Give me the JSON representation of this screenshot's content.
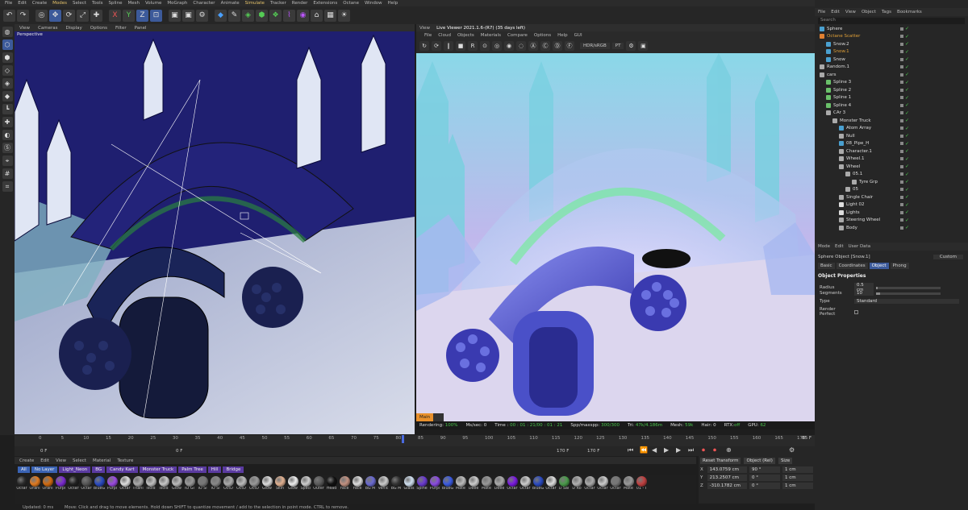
{
  "menubar": [
    "File",
    "Edit",
    "Create",
    "Modes",
    "Select",
    "Tools",
    "Spline",
    "Mesh",
    "Volume",
    "MoGraph",
    "Character",
    "Animate",
    "Simulate",
    "Tracker",
    "Render",
    "Extensions",
    "Octane",
    "Window",
    "Help"
  ],
  "viewport1": {
    "label": "Perspective",
    "menu": [
      "View",
      "Cameras",
      "Display",
      "Options",
      "Filter",
      "Panel"
    ]
  },
  "viewport2": {
    "tabs": [
      "View",
      "Live Viewer 2021.1.6-(R7) (35 days left)"
    ],
    "menu": [
      "File",
      "Cloud",
      "Objects",
      "Materials",
      "Compare",
      "Options",
      "Help",
      "GUI"
    ],
    "color_mode": "HDR/sRGB",
    "pt": "PT",
    "main_tab": "Main",
    "status": {
      "rendering_label": "Rendering:",
      "rendering_val": "100%",
      "mssec": "Ms/sec: 0",
      "time_label": "Time :",
      "time_val": "00 : 01 : 21/00 : 01 : 21",
      "spp_label": "Spp/maxspp:",
      "spp_val": "300/300",
      "tri_label": "Tri:",
      "tri_val": "47k/4.186m",
      "mesh_label": "Mesh:",
      "mesh_val": "59k",
      "hair": "Hair: 0",
      "rtx_label": "RTX:",
      "rtx_val": "off",
      "gpu_label": "GPU:",
      "gpu_val": "62"
    }
  },
  "timeline": {
    "ticks": [
      "0",
      "5",
      "10",
      "15",
      "20",
      "25",
      "30",
      "35",
      "40",
      "45",
      "50",
      "55",
      "60",
      "65",
      "70",
      "75",
      "80",
      "85",
      "90",
      "95",
      "100",
      "105",
      "110",
      "115",
      "120",
      "125",
      "130",
      "135",
      "140",
      "145",
      "150",
      "155",
      "160",
      "165",
      "170"
    ],
    "end": "85 F",
    "start_field": "0 F",
    "current_field": "0 F",
    "end_field": "170 F",
    "max_field": "170 F"
  },
  "materials": {
    "menu": [
      "Create",
      "Edit",
      "View",
      "Select",
      "Material",
      "Texture"
    ],
    "layers": [
      "All",
      "No Layer",
      "Light_Neon",
      "BG",
      "Candy Kart",
      "Monster Truck",
      "Palm Tree",
      "Hill",
      "Bridge"
    ],
    "items": [
      {
        "name": "Octar",
        "color": "#2a2a2a"
      },
      {
        "name": "Orani",
        "color": "#e07a20"
      },
      {
        "name": "Orani",
        "color": "#d06a10"
      },
      {
        "name": "Purpl",
        "color": "#7a2ad0"
      },
      {
        "name": "Octar",
        "color": "#222"
      },
      {
        "name": "Octar",
        "color": "#555"
      },
      {
        "name": "BlueG",
        "color": "#2a4ac0"
      },
      {
        "name": "Purpl",
        "color": "#9a4ae0"
      },
      {
        "name": "Octar",
        "color": "#ddd"
      },
      {
        "name": "Titani",
        "color": "#aaa"
      },
      {
        "name": "isoid",
        "color": "#c0c0c0"
      },
      {
        "name": "isoid",
        "color": "#c8c8c8"
      },
      {
        "name": "Glow",
        "color": "#bbb"
      },
      {
        "name": "IO Gl",
        "color": "#999"
      },
      {
        "name": "IO Sl",
        "color": "#777"
      },
      {
        "name": "IO Sl",
        "color": "#888"
      },
      {
        "name": "OctD",
        "color": "#aaa"
      },
      {
        "name": "OctD",
        "color": "#bbb"
      },
      {
        "name": "OctD",
        "color": "#999"
      },
      {
        "name": "Glow",
        "color": "#dcdcdc"
      },
      {
        "name": "Skin",
        "color": "#e0b090"
      },
      {
        "name": "Glow",
        "color": "#eee"
      },
      {
        "name": "Specl",
        "color": "#ccc"
      },
      {
        "name": "Outer",
        "color": "#5a5a5a"
      },
      {
        "name": "Head",
        "color": "#111"
      },
      {
        "name": "Face",
        "color": "#c09080"
      },
      {
        "name": "Face",
        "color": "#ddd"
      },
      {
        "name": "BG M",
        "color": "#6a6ad0"
      },
      {
        "name": "Vehic",
        "color": "#ccc"
      },
      {
        "name": "BG M",
        "color": "#333"
      },
      {
        "name": "Glass",
        "color": "#d0e0f0"
      },
      {
        "name": "Spine",
        "color": "#6a3ad0"
      },
      {
        "name": "Purpl",
        "color": "#8a4ae0"
      },
      {
        "name": "BlueG",
        "color": "#3a5ae0"
      },
      {
        "name": "Mate",
        "color": "#bbb"
      },
      {
        "name": "Deee",
        "color": "#ccc"
      },
      {
        "name": "Mate",
        "color": "#999"
      },
      {
        "name": "Deee",
        "color": "#aaa"
      },
      {
        "name": "Octar",
        "color": "#7a1ae0"
      },
      {
        "name": "Octar",
        "color": "#ccc"
      },
      {
        "name": "BlueG",
        "color": "#2a4ac0"
      },
      {
        "name": "Octar",
        "color": "#ddd"
      },
      {
        "name": "D Sai",
        "color": "#4a9a4a"
      },
      {
        "name": "D Ro",
        "color": "#b0b0b0"
      },
      {
        "name": "Octar",
        "color": "#aaa"
      },
      {
        "name": "Octar",
        "color": "#ccc"
      },
      {
        "name": "Octar",
        "color": "#777"
      },
      {
        "name": "Mate",
        "color": "#999"
      },
      {
        "name": "01 - I",
        "color": "#c04040"
      }
    ]
  },
  "coords": {
    "reset": "Reset Transform",
    "mode": "Object (Rel)",
    "size": "Size",
    "rows": [
      {
        "axis": "X",
        "pos": "143.0759 cm",
        "rot": "90 °",
        "size": "1 cm"
      },
      {
        "axis": "Y",
        "pos": "213.2507 cm",
        "rot": "0 °",
        "size": "1 cm"
      },
      {
        "axis": "Z",
        "pos": "-310.1782 cm",
        "rot": "0 °",
        "size": "1 cm"
      }
    ]
  },
  "bottom_status": {
    "updated": "Updated: 0 ms",
    "hint": "Move: Click and drag to move elements. Hold down SHIFT to quantize movement / add to the selection in point mode. CTRL to remove."
  },
  "object_manager": {
    "menu": [
      "File",
      "Edit",
      "View",
      "Object",
      "Tags",
      "Bookmarks"
    ],
    "search": "Search",
    "objects": [
      {
        "name": "Sphere",
        "indent": 0,
        "color": "#4aa0d0",
        "sel": false
      },
      {
        "name": "Octane Scatter",
        "indent": 0,
        "color": "#e08030",
        "sel": true
      },
      {
        "name": "Snow.2",
        "indent": 1,
        "color": "#4aa0d0",
        "sel": false
      },
      {
        "name": "Snow.1",
        "indent": 1,
        "color": "#4aa0d0",
        "sel": true
      },
      {
        "name": "Snow",
        "indent": 1,
        "color": "#4aa0d0",
        "sel": false
      },
      {
        "name": "Random.1",
        "indent": 0,
        "color": "#aaa",
        "sel": false
      },
      {
        "name": "cars",
        "indent": 0,
        "color": "#aaa",
        "sel": false
      },
      {
        "name": "Spline 3",
        "indent": 1,
        "color": "#6ac06a",
        "sel": false
      },
      {
        "name": "Spline 2",
        "indent": 1,
        "color": "#6ac06a",
        "sel": false
      },
      {
        "name": "Spline 1",
        "indent": 1,
        "color": "#6ac06a",
        "sel": false
      },
      {
        "name": "Spline 4",
        "indent": 1,
        "color": "#6ac06a",
        "sel": false
      },
      {
        "name": "CAr 3",
        "indent": 1,
        "color": "#aaa",
        "sel": false
      },
      {
        "name": "Monster Truck",
        "indent": 2,
        "color": "#aaa",
        "sel": false
      },
      {
        "name": "Atom Array",
        "indent": 3,
        "color": "#4aa0d0",
        "sel": false
      },
      {
        "name": "Null",
        "indent": 3,
        "color": "#aaa",
        "sel": false
      },
      {
        "name": "08_Pipe_H",
        "indent": 3,
        "color": "#4aa0d0",
        "sel": false
      },
      {
        "name": "Character.1",
        "indent": 3,
        "color": "#aaa",
        "sel": false
      },
      {
        "name": "Wheel.1",
        "indent": 3,
        "color": "#aaa",
        "sel": false
      },
      {
        "name": "Wheel",
        "indent": 3,
        "color": "#aaa",
        "sel": false
      },
      {
        "name": "05.1",
        "indent": 4,
        "color": "#aaa",
        "sel": false
      },
      {
        "name": "Tyre Grp",
        "indent": 5,
        "color": "#aaa",
        "sel": false
      },
      {
        "name": "05",
        "indent": 4,
        "color": "#aaa",
        "sel": false
      },
      {
        "name": "Single Chair",
        "indent": 3,
        "color": "#aaa",
        "sel": false
      },
      {
        "name": "Light 02",
        "indent": 3,
        "color": "#ddd",
        "sel": false
      },
      {
        "name": "Lights",
        "indent": 3,
        "color": "#ddd",
        "sel": false
      },
      {
        "name": "Steering Wheel",
        "indent": 3,
        "color": "#aaa",
        "sel": false
      },
      {
        "name": "Body",
        "indent": 3,
        "color": "#aaa",
        "sel": false
      }
    ]
  },
  "attribute_manager": {
    "menu": [
      "Mode",
      "Edit",
      "User Data"
    ],
    "title": "Sphere Object [Snow.1]",
    "preset": "Custom",
    "tabs": [
      "Basic",
      "Coordinates",
      "Object",
      "Phong"
    ],
    "section": "Object Properties",
    "props": [
      {
        "label": "Radius",
        "value": "0.5 cm",
        "fill": 0.03
      },
      {
        "label": "Segments",
        "value": "10",
        "fill": 0.06
      },
      {
        "label": "Type",
        "value": "Standard"
      },
      {
        "label": "Render Perfect"
      }
    ]
  }
}
